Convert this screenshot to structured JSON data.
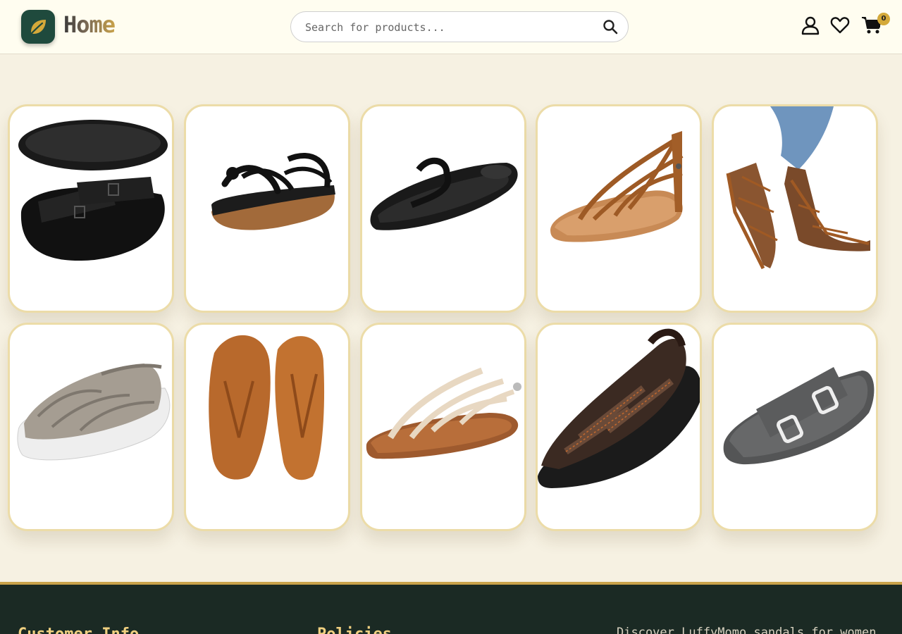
{
  "header": {
    "title": "Home",
    "search_placeholder": "Search for products...",
    "cart_count": "0"
  },
  "products": [
    {
      "icon": "black-double-buckle-slide-sandal-image"
    },
    {
      "icon": "black-strappy-flat-sandal-image"
    },
    {
      "icon": "black-thong-flip-flop-image"
    },
    {
      "icon": "brown-gladiator-toe-ring-sandal-image"
    },
    {
      "icon": "brown-strappy-sandal-on-model-image"
    },
    {
      "icon": "grey-fisherman-sandal-image"
    },
    {
      "icon": "tan-leather-flip-flops-image"
    },
    {
      "icon": "cream-strappy-flat-sandal-image"
    },
    {
      "icon": "black-leather-sport-sandal-image"
    },
    {
      "icon": "grey-double-buckle-slide-image"
    }
  ],
  "footer": {
    "customer_info_heading": "Customer Info",
    "policies_heading": "Policies",
    "about_text": "Discover LuffyMomo sandals for women"
  },
  "colors": {
    "brand_green": "#1f4a3d",
    "accent_gold": "#c9a24a",
    "page_bg": "#f6f1e2",
    "footer_bg": "#1b2a24"
  }
}
